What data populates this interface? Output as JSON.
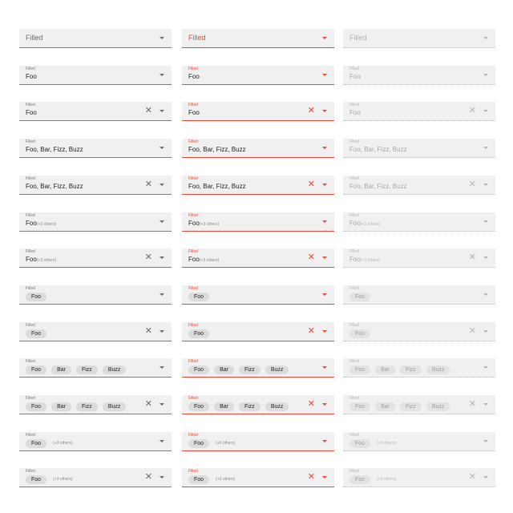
{
  "label": "Filled",
  "placeholder": "Filled",
  "single_value": "Foo",
  "multi_text": "Foo, Bar, Fizz, Buzz",
  "collapsed_first": "Foo",
  "collapsed_more": "(+3 others)",
  "chips": [
    "Foo",
    "Bar",
    "Fizz",
    "Buzz"
  ],
  "clear_glyph": "✕",
  "icons": {
    "dropdown": "chevron-down-icon",
    "clear": "close-icon"
  },
  "columns": [
    {
      "name": "default",
      "line_color": "#7d7d7d"
    },
    {
      "name": "error",
      "line_color": "#f44336"
    },
    {
      "name": "disabled",
      "line_color": "#bdbdbd"
    }
  ],
  "rows": [
    {
      "kind": "placeholder",
      "clear": false
    },
    {
      "kind": "single",
      "clear": false
    },
    {
      "kind": "single",
      "clear": true
    },
    {
      "kind": "multi",
      "clear": false
    },
    {
      "kind": "multi",
      "clear": true
    },
    {
      "kind": "collapsed",
      "clear": false
    },
    {
      "kind": "collapsed",
      "clear": true
    },
    {
      "kind": "chip1",
      "clear": false
    },
    {
      "kind": "chip1",
      "clear": true
    },
    {
      "kind": "chips",
      "clear": false
    },
    {
      "kind": "chips",
      "clear": true
    },
    {
      "kind": "chipmore",
      "clear": false
    },
    {
      "kind": "chipmore",
      "clear": true
    }
  ]
}
